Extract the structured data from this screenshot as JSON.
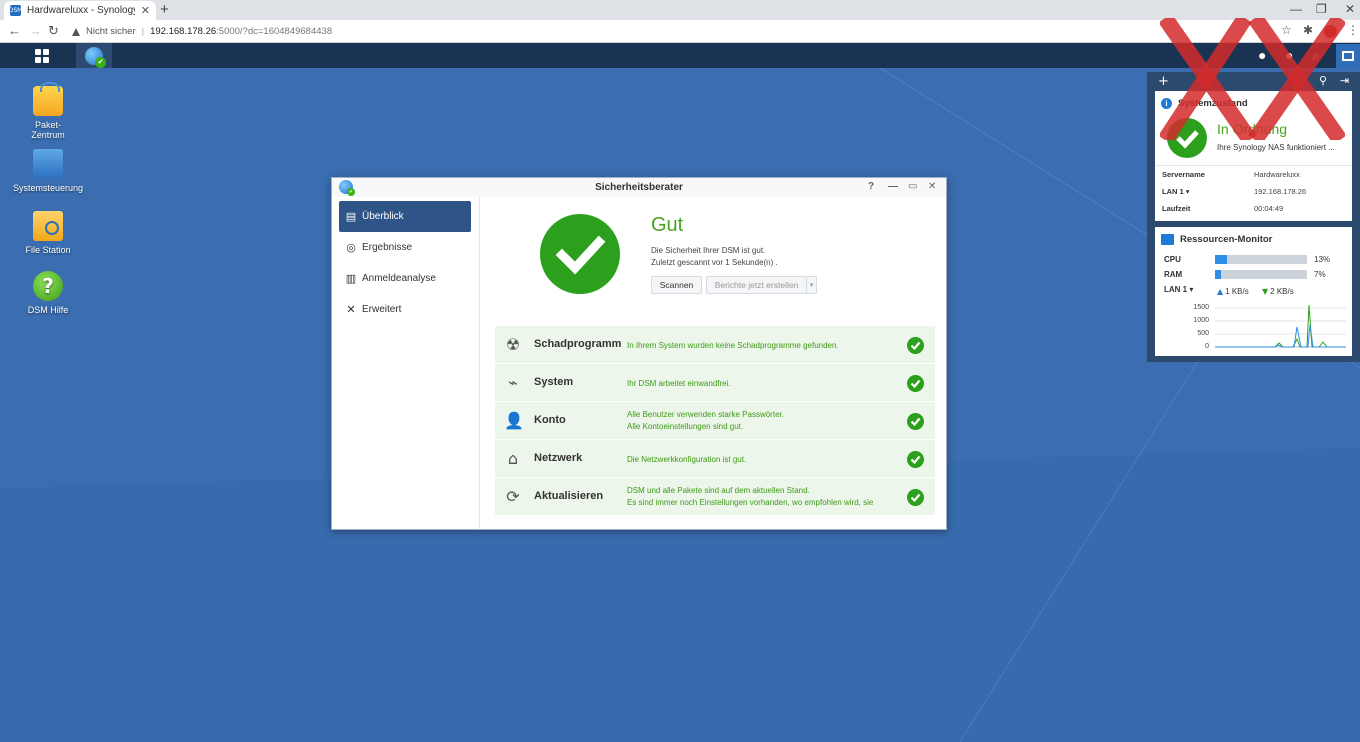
{
  "browser": {
    "tab_title": "Hardwareluxx - Synology NAS",
    "favicon_text": "DSM",
    "not_secure": "Nicht sicher",
    "url_host": "192.168.178.26",
    "url_rest": ":5000/?dc=1604849684438"
  },
  "desktop": {
    "icons": [
      {
        "label_line1": "Paket-",
        "label_line2": "Zentrum",
        "icon": "package-icon"
      },
      {
        "label_line1": "Systemsteuerung",
        "label_line2": "",
        "icon": "control-panel-icon"
      },
      {
        "label_line1": "File Station",
        "label_line2": "",
        "icon": "folder-icon"
      },
      {
        "label_line1": "DSM Hilfe",
        "label_line2": "",
        "icon": "help-icon"
      }
    ]
  },
  "window": {
    "title": "Sicherheitsberater",
    "sidebar": [
      {
        "label": "Überblick",
        "icon": "overview-icon",
        "active": true
      },
      {
        "label": "Ergebnisse",
        "icon": "results-icon",
        "active": false
      },
      {
        "label": "Anmeldeanalyse",
        "icon": "chart-icon",
        "active": false
      },
      {
        "label": "Erweitert",
        "icon": "tools-icon",
        "active": false
      }
    ],
    "status": {
      "title": "Gut",
      "line1": "Die Sicherheit Ihrer DSM ist gut.",
      "line2": "Zuletzt gescannt vor 1 Sekunde(n) ."
    },
    "buttons": {
      "scan": "Scannen",
      "report": "Berichte jetzt erstellen",
      "caret": "▾"
    },
    "results": [
      {
        "name": "Schadprogramm",
        "icon": "radiation-icon",
        "desc1": "In Ihrem System wurden keine Schadprogramme gefunden.",
        "desc2": ""
      },
      {
        "name": "System",
        "icon": "system-monitor-icon",
        "desc1": "Ihr DSM arbeitet einwandfrei.",
        "desc2": ""
      },
      {
        "name": "Konto",
        "icon": "user-icon",
        "desc1": "Alle Benutzer verwenden starke Passwörter.",
        "desc2": "Alle Kontoeinstellungen sind gut."
      },
      {
        "name": "Netzwerk",
        "icon": "network-icon",
        "desc1": "Die Netzwerkkonfiguration ist gut.",
        "desc2": ""
      },
      {
        "name": "Aktualisieren",
        "icon": "refresh-icon",
        "desc1": "DSM und alle Pakete sind auf dem aktuellen Stand.",
        "desc2": "Es sind immer noch Einstellungen vorhanden, wo empfohlen wird, sie"
      }
    ]
  },
  "widgets": {
    "health": {
      "title": "Systemzustand",
      "state": "In Ordnung",
      "desc": "Ihre Synology NAS funktioniert ...",
      "server_label": "Servername",
      "server_value": "Hardwareluxx",
      "lan_label": "LAN 1 ▾",
      "lan_value": "192.168.178.26",
      "uptime_label": "Laufzeit",
      "uptime_value": "00:04:49"
    },
    "resources": {
      "title": "Ressourcen-Monitor",
      "cpu_label": "CPU",
      "cpu_pct": "13%",
      "cpu_value": 0.13,
      "ram_label": "RAM",
      "ram_pct": "7%",
      "ram_value": 0.07,
      "lan_label": "LAN 1 ▾",
      "upload": "1 KB/s",
      "download": "2 KB/s",
      "y_ticks": [
        "1500",
        "1000",
        "500",
        "0"
      ]
    }
  },
  "colors": {
    "accent": "#2e5488",
    "ok_green": "#2ca01c",
    "desktop": "#3b6db1",
    "taskbar": "#1b3352"
  }
}
